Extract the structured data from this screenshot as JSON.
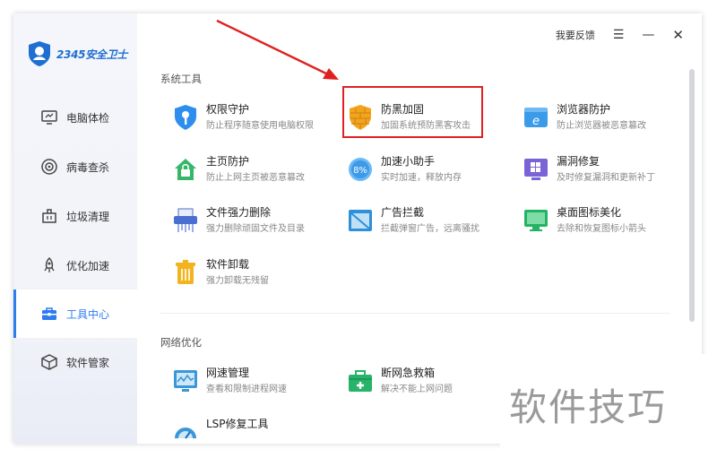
{
  "app": {
    "logo_text": "2345安全卫士"
  },
  "topbar": {
    "feedback": "我要反馈"
  },
  "sidebar": {
    "items": [
      {
        "label": "电脑体检",
        "icon": "monitor-icon"
      },
      {
        "label": "病毒查杀",
        "icon": "target-icon"
      },
      {
        "label": "垃圾清理",
        "icon": "trash-can-icon"
      },
      {
        "label": "优化加速",
        "icon": "rocket-icon"
      },
      {
        "label": "工具中心",
        "icon": "toolbox-icon",
        "active": true
      },
      {
        "label": "软件管家",
        "icon": "box-icon"
      }
    ]
  },
  "sections": [
    {
      "title": "系统工具",
      "tools": [
        {
          "name": "权限守护",
          "desc": "防止程序随意使用电脑权限",
          "icon": "key-shield-icon"
        },
        {
          "name": "防黑加固",
          "desc": "加固系统预防黑客攻击",
          "icon": "firewall-shield-icon",
          "highlighted": true
        },
        {
          "name": "浏览器防护",
          "desc": "防止浏览器被恶意篡改",
          "icon": "browser-shield-icon"
        },
        {
          "name": "主页防护",
          "desc": "防止上网主页被恶意篡改",
          "icon": "home-lock-icon"
        },
        {
          "name": "加速小助手",
          "desc": "实时加速，释放内存",
          "icon": "speed-ball-icon"
        },
        {
          "name": "漏洞修复",
          "desc": "及时修复漏洞和更新补丁",
          "icon": "windows-patch-icon"
        },
        {
          "name": "文件强力删除",
          "desc": "强力删除顽固文件及目录",
          "icon": "shredder-icon"
        },
        {
          "name": "广告拦截",
          "desc": "拦截弹窗广告，远离骚扰",
          "icon": "ad-block-icon"
        },
        {
          "name": "桌面图标美化",
          "desc": "去除和恢复图标小箭头",
          "icon": "desktop-icon"
        },
        {
          "name": "软件卸载",
          "desc": "强力卸载无残留",
          "icon": "uninstall-bin-icon"
        }
      ]
    },
    {
      "title": "网络优化",
      "tools": [
        {
          "name": "网速管理",
          "desc": "查看和限制进程网速",
          "icon": "network-monitor-icon"
        },
        {
          "name": "断网急救箱",
          "desc": "解决不能上网问题",
          "icon": "first-aid-kit-icon"
        },
        {
          "name": "LSP修复工具",
          "desc": "",
          "icon": "gauge-icon"
        }
      ]
    }
  ],
  "watermark": "软件技巧",
  "colors": {
    "accent": "#2d7cf0",
    "highlight": "#e02020"
  }
}
